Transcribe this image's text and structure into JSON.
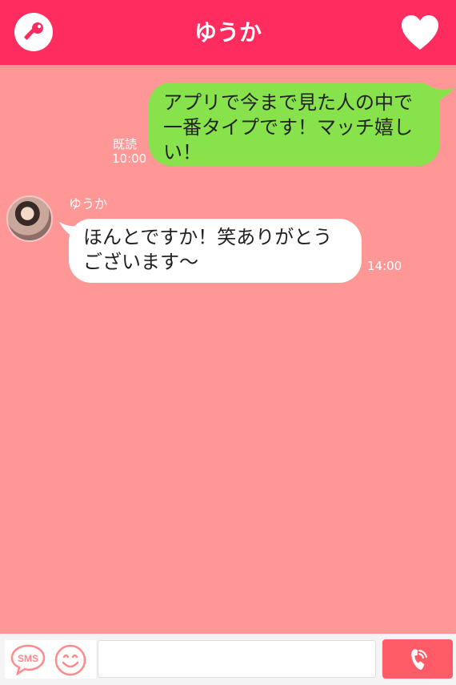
{
  "header": {
    "title": "ゆうか",
    "left_icon": "key-icon",
    "right_icon": "heart-icon"
  },
  "messages": {
    "sent": {
      "text": "アプリで今まで見た人の中で一番タイプです！マッチ嬉しい！",
      "read_label": "既読",
      "time": "10:00"
    },
    "received": {
      "sender": "ゆうか",
      "text": "ほんとですか！笑ありがとうございます〜",
      "time": "14:00"
    }
  },
  "footer": {
    "sms_icon_label": "SMS",
    "smile_icon": "smile-icon",
    "input_value": "",
    "call_icon": "phone-icon"
  },
  "colors": {
    "header": "#ff2d5f",
    "background": "#ff9797",
    "sent_bubble": "#88e24b",
    "received_bubble": "#ffffff",
    "call_button": "#ff5c68"
  }
}
